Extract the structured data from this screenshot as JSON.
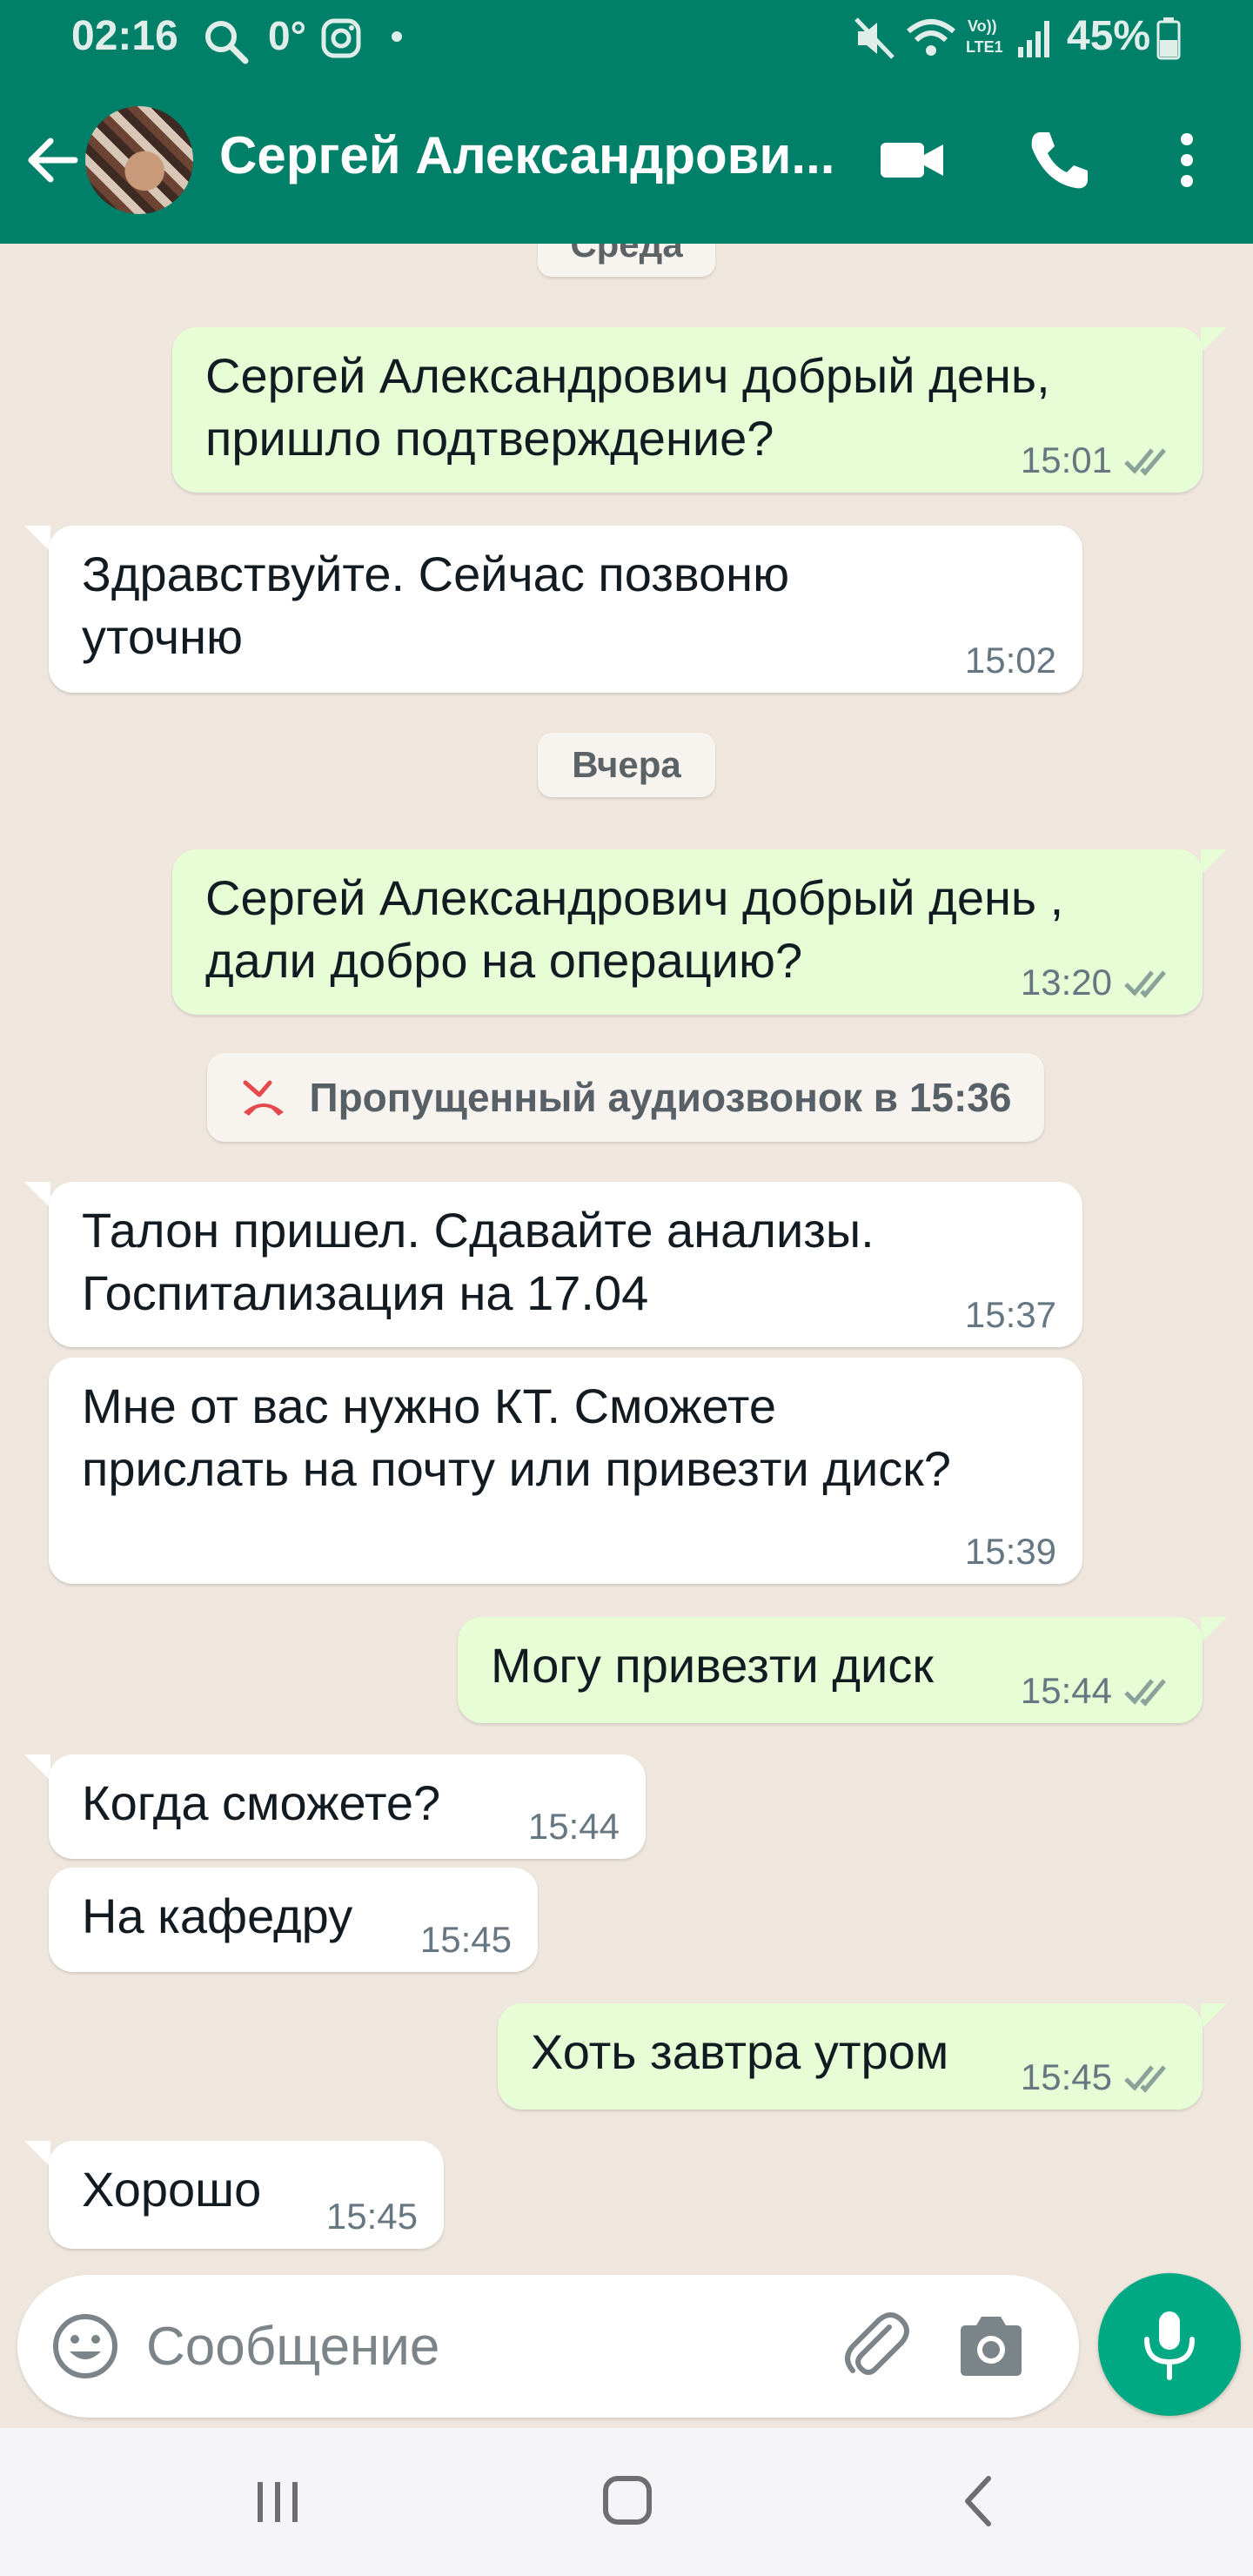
{
  "status_bar": {
    "time": "02:16",
    "temperature": "0°",
    "battery": "45%",
    "icons": [
      "search-icon",
      "instagram-icon",
      "dot-icon",
      "mute-icon",
      "wifi-icon",
      "volte-icon",
      "signal-icon",
      "battery-icon"
    ]
  },
  "app_bar": {
    "contact_name": "Сергей Александрови...",
    "icons": [
      "back-arrow-icon",
      "video-call-icon",
      "voice-call-icon",
      "more-options-icon"
    ]
  },
  "chat": {
    "date_chips": [
      "Среда",
      "Вчера"
    ],
    "missed_call": "Пропущенный аудиозвонок в 15:36",
    "messages": [
      {
        "direction": "out",
        "text": "Сергей Александрович добрый день,\nпришло подтверждение?",
        "time": "15:01",
        "status": "read"
      },
      {
        "direction": "in",
        "text": "Здравствуйте. Сейчас позвоню\nуточню",
        "time": "15:02"
      },
      {
        "direction": "out",
        "text": "Сергей Александрович добрый день ,\nдали добро на операцию?",
        "time": "13:20",
        "status": "read"
      },
      {
        "direction": "in",
        "text": "Талон пришел. Сдавайте анализы.\nГоспитализация на 17.04",
        "time": "15:37"
      },
      {
        "direction": "in",
        "text": "Мне от вас нужно КТ. Сможете\nприслать на почту или привезти диск?",
        "time": "15:39"
      },
      {
        "direction": "out",
        "text": "Могу привезти диск",
        "time": "15:44",
        "status": "read"
      },
      {
        "direction": "in",
        "text": "Когда сможете?",
        "time": "15:44"
      },
      {
        "direction": "in",
        "text": "На кафедру",
        "time": "15:45"
      },
      {
        "direction": "out",
        "text": "Хоть завтра утром",
        "time": "15:45",
        "status": "read"
      },
      {
        "direction": "in",
        "text": "Хорошо",
        "time": "15:45"
      }
    ]
  },
  "composer": {
    "placeholder": "Сообщение",
    "icons": [
      "emoji-icon",
      "attach-icon",
      "camera-icon",
      "mic-icon"
    ]
  },
  "nav_bar": {
    "icons": [
      "recent-apps-icon",
      "home-icon",
      "back-icon"
    ]
  },
  "colors": {
    "header": "#008069",
    "chat_background": "#efe7de",
    "outgoing_bubble": "#e7fdd5",
    "incoming_bubble": "#ffffff",
    "accent": "#00a884",
    "missed_call": "#e5484d"
  }
}
